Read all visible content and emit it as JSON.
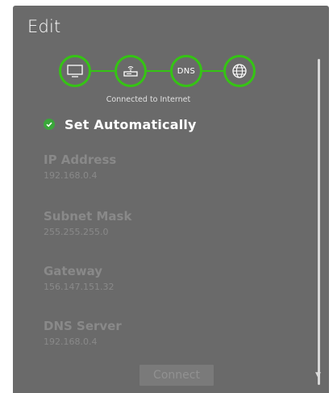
{
  "dialog": {
    "title": "Edit"
  },
  "network_status": {
    "nodes": [
      {
        "icon": "tv-icon"
      },
      {
        "icon": "router-icon"
      },
      {
        "label": "DNS"
      },
      {
        "icon": "globe-icon"
      }
    ],
    "status_text": "Connected to Internet",
    "accent_color": "#35c414"
  },
  "settings": {
    "auto_label": "Set Automatically",
    "auto_checked": true,
    "fields": [
      {
        "label": "IP Address",
        "value": "192.168.0.4"
      },
      {
        "label": "Subnet Mask",
        "value": "255.255.255.0"
      },
      {
        "label": "Gateway",
        "value": "156.147.151.32"
      },
      {
        "label": "DNS Server",
        "value": "192.168.0.4"
      }
    ],
    "connect_label": "Connect"
  }
}
